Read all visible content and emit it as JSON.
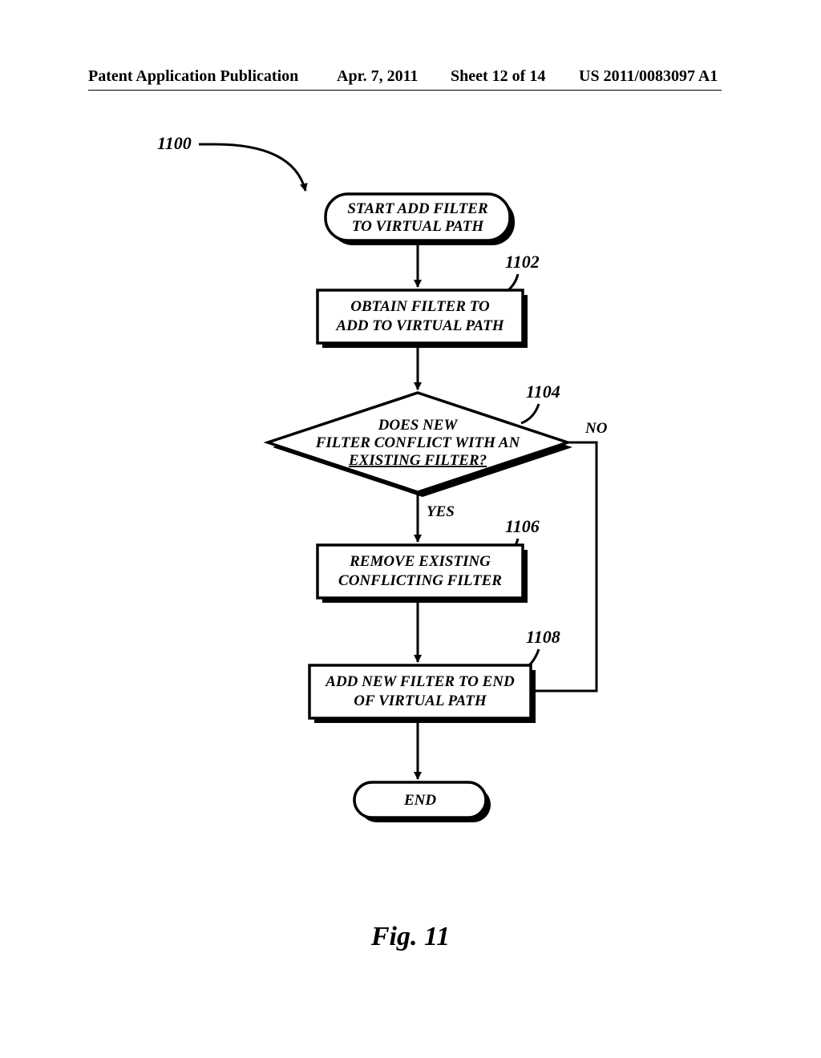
{
  "header": {
    "publication": "Patent Application Publication",
    "date": "Apr. 7, 2011",
    "sheet": "Sheet 12 of 14",
    "number": "US 2011/0083097 A1"
  },
  "refs": {
    "main": "1100",
    "r1": "1102",
    "r2": "1104",
    "r3": "1106",
    "r4": "1108"
  },
  "nodes": {
    "start_l1": "START ADD FILTER",
    "start_l2": "TO VIRTUAL PATH",
    "obtain_l1": "OBTAIN FILTER TO",
    "obtain_l2": "ADD TO VIRTUAL PATH",
    "dec_l1": "DOES NEW",
    "dec_l2": "FILTER CONFLICT WITH AN",
    "dec_l3": "EXISTING FILTER?",
    "remove_l1": "REMOVE EXISTING",
    "remove_l2": "CONFLICTING FILTER",
    "add_l1": "ADD NEW FILTER TO END",
    "add_l2": "OF VIRTUAL PATH",
    "end": "END"
  },
  "labels": {
    "yes": "YES",
    "no": "NO"
  },
  "figure": "Fig. 11"
}
